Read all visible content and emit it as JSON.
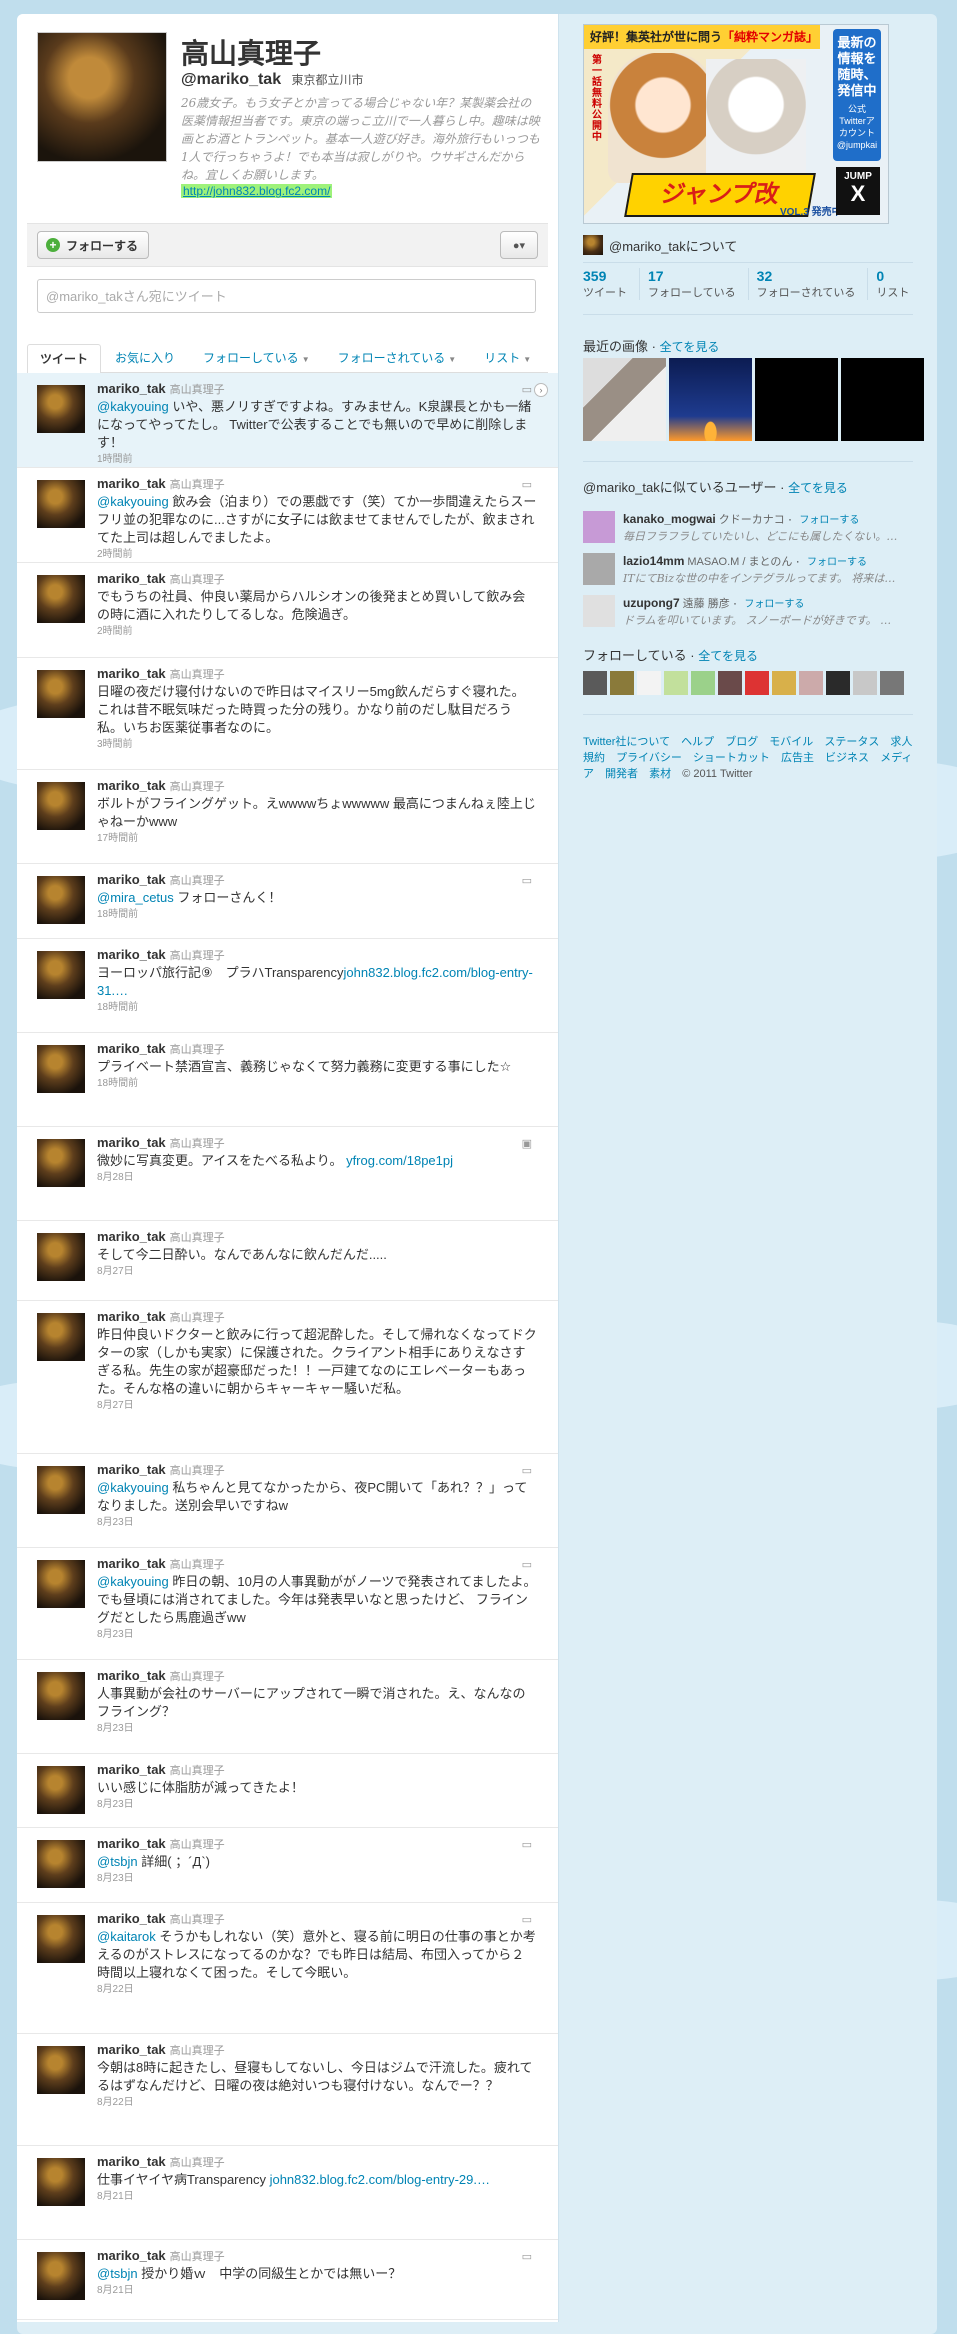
{
  "profile": {
    "name": "高山真理子",
    "screen_name": "@mariko_tak",
    "location": "東京都立川市",
    "bio": "26歳女子。もう女子とか言ってる場合じゃない年？某製薬会社の医薬情報担当者です。東京の端っこ立川で一人暮らし中。趣味は映画とお酒とトランペット。基本一人遊び好き。海外旅行もいっつも1人で行っちゃうよ！でも本当は寂しがりや。ウサギさんだからね。宜しくお願いします。",
    "url": "http://john832.blog.fc2.com/"
  },
  "actions": {
    "follow_label": "フォローする",
    "user_menu_icon": "user-dropdown-icon",
    "tweet_placeholder": "@mariko_takさん宛にツイート"
  },
  "tabs": [
    {
      "label": "ツイート",
      "active": true
    },
    {
      "label": "お気に入り"
    },
    {
      "label": "フォローしている"
    },
    {
      "label": "フォローされている"
    },
    {
      "label": "リスト"
    }
  ],
  "tweets": [
    {
      "user": "mariko_tak",
      "name": "高山真理子",
      "mention": "@kakyouing",
      "text": " いや、悪ノリすぎですよね。すみません。K泉課長とかも一緒になってやってたし。 Twitterで公表することでも無いので早めに削除します！",
      "time": "1時間前"
    },
    {
      "user": "mariko_tak",
      "name": "高山真理子",
      "mention": "@kakyouing",
      "text": " 飲み会（泊まり）での悪戯です（笑）てか一歩間違えたらスーフリ並の犯罪なのに...さすがに女子には飲ませてませんでしたが、飲まされてた上司は超しんでましたよ。",
      "time": "2時間前"
    },
    {
      "user": "mariko_tak",
      "name": "高山真理子",
      "mention": "",
      "text": "でもうちの社員、仲良い薬局からハルシオンの後発まとめ買いして飲み会の時に酒に入れたりしてるしな。危険過ぎ。",
      "time": "2時間前"
    },
    {
      "user": "mariko_tak",
      "name": "高山真理子",
      "mention": "",
      "text": "日曜の夜だけ寝付けないので昨日はマイスリー5mg飲んだらすぐ寝れた。これは昔不眠気味だった時買った分の残り。かなり前のだし駄目だろう私。いちお医薬従事者なのに。",
      "time": "3時間前"
    },
    {
      "user": "mariko_tak",
      "name": "高山真理子",
      "mention": "",
      "text": "ボルトがフライングゲット。えwwwwちょwwwww 最高につまんねぇ陸上じゃねーかwww",
      "time": "17時間前"
    },
    {
      "user": "mariko_tak",
      "name": "高山真理子",
      "mention": "@mira_cetus",
      "text": " フォローさんく！",
      "time": "18時間前"
    },
    {
      "user": "mariko_tak",
      "name": "高山真理子",
      "mention": "",
      "text": "ヨーロッパ旅行記⑨　プラハTransparency",
      "link": "john832.blog.fc2.com/blog-entry-31.…",
      "time": "18時間前"
    },
    {
      "user": "mariko_tak",
      "name": "高山真理子",
      "mention": "",
      "text": "プライベート禁酒宣言、義務じゃなくて努力義務に変更する事にした☆",
      "time": "18時間前"
    },
    {
      "user": "mariko_tak",
      "name": "高山真理子",
      "mention": "",
      "text": "微妙に写真変更。アイスをたべる私より。 ",
      "link": "yfrog.com/18pe1pj",
      "time": "8月28日"
    },
    {
      "user": "mariko_tak",
      "name": "高山真理子",
      "mention": "",
      "text": "そして今二日酔い。なんであんなに飲んだんだ.....",
      "time": "8月27日"
    },
    {
      "user": "mariko_tak",
      "name": "高山真理子",
      "mention": "",
      "text": "昨日仲良いドクターと飲みに行って超泥酔した。そして帰れなくなってドクターの家（しかも実家）に保護された。クライアント相手にありえなさすぎる私。先生の家が超豪邸だった！！一戸建てなのにエレベーターもあった。そんな格の違いに朝からキャーキャー騒いだ私。",
      "time": "8月27日"
    },
    {
      "user": "mariko_tak",
      "name": "高山真理子",
      "mention": "@kakyouing",
      "text": " 私ちゃんと見てなかったから、夜PC開いて「あれ？？」ってなりました。送別会早いですねw",
      "time": "8月23日"
    },
    {
      "user": "mariko_tak",
      "name": "高山真理子",
      "mention": "@kakyouing",
      "text": " 昨日の朝、10月の人事異動ががノーツで発表されてましたよ。でも昼頃には消されてました。今年は発表早いなと思ったけど、 フライングだとしたら馬鹿過ぎww",
      "time": "8月23日"
    },
    {
      "user": "mariko_tak",
      "name": "高山真理子",
      "mention": "",
      "text": "人事異動が会社のサーバーにアップされて一瞬で消された。え、なんなのフライング？",
      "time": "8月23日"
    },
    {
      "user": "mariko_tak",
      "name": "高山真理子",
      "mention": "",
      "text": "いい感じに体脂肪が減ってきたよ！",
      "time": "8月23日"
    },
    {
      "user": "mariko_tak",
      "name": "高山真理子",
      "mention": "@tsbjn",
      "text": " 詳細( ；´Д`)",
      "time": "8月23日"
    },
    {
      "user": "mariko_tak",
      "name": "高山真理子",
      "mention": "@kaitarok",
      "text": " そうかもしれない（笑）意外と、寝る前に明日の仕事の事とか考えるのがストレスになってるのかな？でも昨日は結局、布団入ってから２時間以上寝れなくて困った。そして今眠い。",
      "time": "8月22日"
    },
    {
      "user": "mariko_tak",
      "name": "高山真理子",
      "mention": "",
      "text": "今朝は8時に起きたし、昼寝もしてないし、今日はジムで汗流した。疲れてるはずなんだけど、日曜の夜は絶対いつも寝付けない。なんでー？？",
      "time": "8月22日"
    },
    {
      "user": "mariko_tak",
      "name": "高山真理子",
      "mention": "",
      "text": "仕事イヤイヤ病Transparency ",
      "link": "john832.blog.fc2.com/blog-entry-29.…",
      "time": "8月21日"
    },
    {
      "user": "mariko_tak",
      "name": "高山真理子",
      "mention": "@tsbjn",
      "text": " 授かり婚ｗ　中学の同級生とかでは無いー？",
      "time": "8月21日"
    }
  ],
  "ad": {
    "banner_a": "好評！集英社が世に問う",
    "banner_b": "「純粋マンガ誌」",
    "side_text": "第一話無料公開中",
    "logo": "ジャンプ改",
    "vol": "VOL.3 発売中",
    "blue_big": "最新の情報を随時、発信中",
    "blue_small": "公式Twitterアカウント @jumpkai",
    "jump_top": "JUMP",
    "jump_x": "X"
  },
  "sidebar": {
    "about": "@mariko_takについて",
    "stats": [
      {
        "n": "359",
        "l": "ツイート"
      },
      {
        "n": "17",
        "l": "フォローしている"
      },
      {
        "n": "32",
        "l": "フォローされている"
      },
      {
        "n": "0",
        "l": "リスト"
      }
    ],
    "recent_images_title": "最近の画像",
    "see_all": "全てを見る",
    "similar_title": "@mariko_takに似ているユーザー",
    "similar": [
      {
        "user": "kanako_mogwai",
        "name": "クドーカナコ",
        "follow": "フォローする",
        "desc": "毎日フラフラしていたいし、どこにも属したくない。…",
        "color": "#c79ad6"
      },
      {
        "user": "lazio14mm",
        "name": "MASAO.M / まとのん",
        "follow": "フォローする",
        "desc": "ITにてBizな世の中をインテグラルってます。 将来は…",
        "color": "#a9a9a9"
      },
      {
        "user": "uzupong7",
        "name": "遠藤 勝彦",
        "follow": "フォローする",
        "desc": "ドラムを叩いています。 スノーボードが好きです。 …",
        "color": "#e0e0e0"
      }
    ],
    "following_title": "フォローしている",
    "following_colors": [
      "#5a5a5a",
      "#8a7a3a",
      "#f3f3f3",
      "#c2e09c",
      "#9bd18a",
      "#6a4a4a",
      "#d33",
      "#d8b04a",
      "#caa",
      "#2a2a2a",
      "#c8c8c8",
      "#777"
    ],
    "footer_links": [
      "Twitter社について",
      "ヘルプ",
      "ブログ",
      "モバイル",
      "ステータス",
      "求人",
      "規約",
      "プライバシー",
      "ショートカット",
      "広告主",
      "ビジネス",
      "メディア",
      "開発者",
      "素材"
    ],
    "copyright": "© 2011 Twitter"
  }
}
